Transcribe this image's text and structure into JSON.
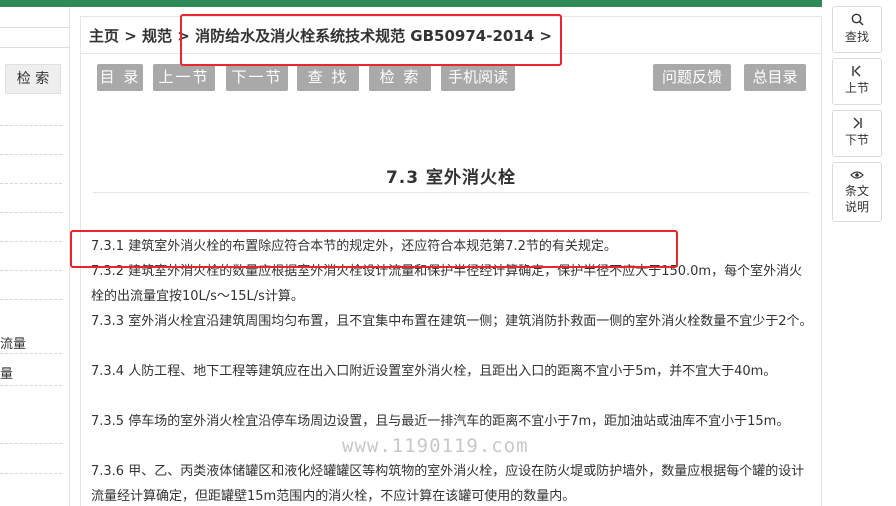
{
  "sidebar": {
    "search_label": "检 索",
    "items": [
      "流量",
      "量"
    ]
  },
  "breadcrumb": {
    "home": "主页",
    "sep1": " > ",
    "spec": "规范",
    "sep2": " > ",
    "title": "消防给水及消火栓系统技术规范 GB50974-2014 >"
  },
  "toolbar": {
    "toc": "目 录",
    "prev": "上一节",
    "next": "下一节",
    "find": "查 找",
    "search": "检 索",
    "mobile": "手机阅读",
    "feedback": "问题反馈",
    "all_toc": "总目录"
  },
  "section": {
    "title": "7.3  室外消火栓",
    "paragraphs": [
      "7.3.1 建筑室外消火栓的布置除应符合本节的规定外，还应符合本规范第7.2节的有关规定。",
      "7.3.2 建筑室外消火栓的数量应根据室外消火栓设计流量和保护半径经计算确定，保护半径不应大于150.0m，每个室外消火栓的出流量宜按10L/s～15L/s计算。",
      "7.3.3 室外消火栓宜沿建筑周围均匀布置，且不宜集中布置在建筑一侧；建筑消防扑救面一侧的室外消火栓数量不宜少于2个。",
      "7.3.4 人防工程、地下工程等建筑应在出入口附近设置室外消火栓，且距出入口的距离不宜小于5m，并不宜大于40m。",
      "7.3.5 停车场的室外消火栓宜沿停车场周边设置，且与最近一排汽车的距离不宜小于7m，距加油站或油库不宜小于15m。",
      "7.3.6 甲、乙、丙类液体储罐区和液化烃罐罐区等构筑物的室外消火栓，应设在防火堤或防护墙外，数量应根据每个罐的设计流量经计算确定，但距罐壁15m范围内的消火栓，不应计算在该罐可使用的数量内。"
    ]
  },
  "watermark": "www.1190119.com",
  "right_tools": {
    "find_label": "查找",
    "prev_label": "上节",
    "next_label": "下节",
    "explain_label": "条文说明",
    "find_icon": "search-icon",
    "prev_icon": "first-page-icon",
    "next_icon": "last-page-icon",
    "explain_icon": "eye-icon"
  },
  "colors": {
    "topbar": "#2e8b57",
    "button": "#a9a9a9",
    "highlight": "#e8262c"
  }
}
